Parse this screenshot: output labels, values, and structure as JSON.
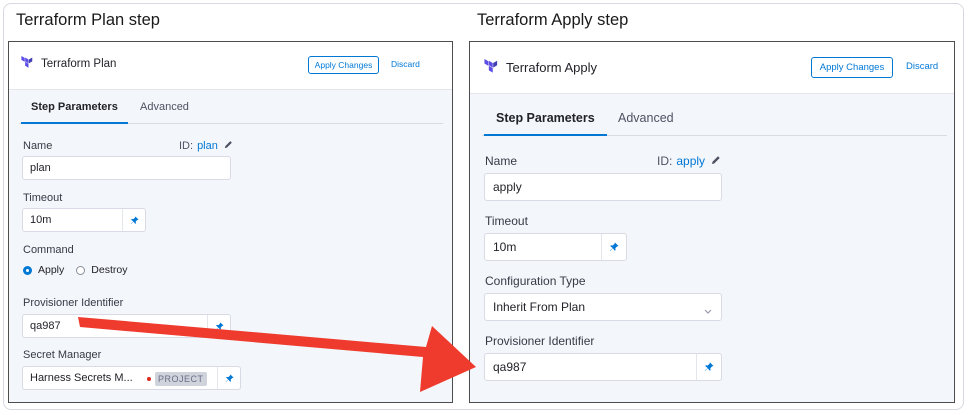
{
  "captions": {
    "left": "Terraform Plan step",
    "right": "Terraform Apply step"
  },
  "colors": {
    "accent": "#0278d5",
    "arrow": "#ef3b2d",
    "panel_bg": "#f3f6fa",
    "terraform_purple": "#5c4ee5"
  },
  "plan": {
    "title": "Terraform Plan",
    "icon": "terraform-icon",
    "apply_changes": "Apply Changes",
    "discard": "Discard",
    "tabs": [
      "Step Parameters",
      "Advanced"
    ],
    "name_label": "Name",
    "id_label": "ID:",
    "id_value": "plan",
    "name_value": "plan",
    "timeout_label": "Timeout",
    "timeout_value": "10m",
    "command_label": "Command",
    "command_options": [
      "Apply",
      "Destroy"
    ],
    "command_selected": "Apply",
    "provisioner_label": "Provisioner Identifier",
    "provisioner_value": "qa987",
    "secret_label": "Secret Manager",
    "secret_value": "Harness Secrets M...",
    "secret_badge": "PROJECT"
  },
  "apply": {
    "title": "Terraform Apply",
    "icon": "terraform-icon",
    "apply_changes": "Apply Changes",
    "discard": "Discard",
    "tabs": [
      "Step Parameters",
      "Advanced"
    ],
    "name_label": "Name",
    "id_label": "ID:",
    "id_value": "apply",
    "name_value": "apply",
    "timeout_label": "Timeout",
    "timeout_value": "10m",
    "config_type_label": "Configuration Type",
    "config_type_value": "Inherit From Plan",
    "provisioner_label": "Provisioner Identifier",
    "provisioner_value": "qa987"
  }
}
